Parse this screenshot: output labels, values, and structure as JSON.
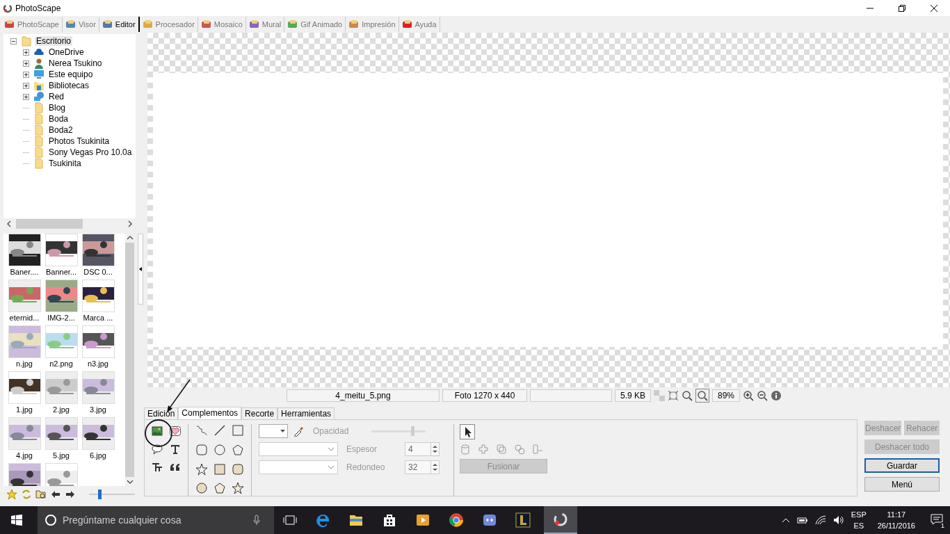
{
  "window": {
    "title": "PhotoScape"
  },
  "tabs": [
    {
      "label": "PhotoScape",
      "selected": false
    },
    {
      "label": "Visor",
      "selected": false
    },
    {
      "label": "Editor",
      "selected": true
    },
    {
      "label": "Procesador",
      "selected": false
    },
    {
      "label": "Mosaico",
      "selected": false
    },
    {
      "label": "Mural",
      "selected": false
    },
    {
      "label": "Gif Animado",
      "selected": false
    },
    {
      "label": "Impresión",
      "selected": false
    },
    {
      "label": "Ayuda",
      "selected": false
    }
  ],
  "folder_tree": {
    "label": "Escritorio",
    "expanded": true,
    "selected": true,
    "children": [
      {
        "label": "OneDrive",
        "kind": "cloud",
        "expandable": true
      },
      {
        "label": "Nerea Tsukino",
        "kind": "person",
        "expandable": true
      },
      {
        "label": "Este equipo",
        "kind": "computer",
        "expandable": true
      },
      {
        "label": "Bibliotecas",
        "kind": "library",
        "expandable": true
      },
      {
        "label": "Red",
        "kind": "network",
        "expandable": true
      },
      {
        "label": "Blog",
        "kind": "folder",
        "expandable": false
      },
      {
        "label": "Boda",
        "kind": "folder",
        "expandable": false
      },
      {
        "label": "Boda2",
        "kind": "folder",
        "expandable": false
      },
      {
        "label": "Photos Tsukinita",
        "kind": "folder",
        "expandable": false
      },
      {
        "label": "Sony Vegas Pro 10.0a",
        "kind": "folder",
        "expandable": false
      },
      {
        "label": "Tsukinita",
        "kind": "folder",
        "expandable": false
      }
    ]
  },
  "thumbnails": [
    {
      "caption": "Baner...."
    },
    {
      "caption": "Banner..."
    },
    {
      "caption": "DSC  0..."
    },
    {
      "caption": "eternid..."
    },
    {
      "caption": "IMG-2..."
    },
    {
      "caption": "Marca ..."
    },
    {
      "caption": "n.jpg"
    },
    {
      "caption": "n2.png"
    },
    {
      "caption": "n3.jpg"
    },
    {
      "caption": "1.jpg"
    },
    {
      "caption": "2.jpg"
    },
    {
      "caption": "3.jpg"
    },
    {
      "caption": "4.jpg"
    },
    {
      "caption": "5.jpg"
    },
    {
      "caption": "6.jpg"
    },
    {
      "kind": "picture"
    },
    {
      "kind": "picture"
    }
  ],
  "thumbnail_size": {
    "level": 0.2
  },
  "status_bar": {
    "file_name": "4_meitu_5.png",
    "dimensions": "Foto 1270 x 440",
    "file_size": "5.9 KB",
    "zoom": "89%"
  },
  "editor_tabs": [
    {
      "label": "Edición",
      "selected": false
    },
    {
      "label": "Complementos",
      "selected": true
    },
    {
      "label": "Recorte",
      "selected": false
    },
    {
      "label": "Herramientas",
      "selected": false
    }
  ],
  "options": {
    "opacity_label": "Opacidad",
    "opacity": {
      "level": 0.75
    },
    "thickness_label": "Espesor",
    "thickness": "4",
    "rounding_label": "Redondeo",
    "rounding": "32",
    "merge_button": {
      "label": "Fusionar",
      "disabled": true
    }
  },
  "actions": [
    {
      "label": "Deshacer",
      "disabled": true,
      "focused": false
    },
    {
      "label": "Rehacer",
      "disabled": true,
      "focused": false
    },
    {
      "label": "Deshacer todo",
      "disabled": true,
      "focused": false
    },
    {
      "label": "Guardar",
      "disabled": false,
      "focused": true
    },
    {
      "label": "Menú",
      "disabled": false,
      "focused": false
    }
  ],
  "taskbar": {
    "search_placeholder": "Pregúntame cualquier cosa",
    "language": "ESP",
    "layout": "ES",
    "time": "11:17",
    "date": "26/11/2016",
    "notifications": "1"
  }
}
